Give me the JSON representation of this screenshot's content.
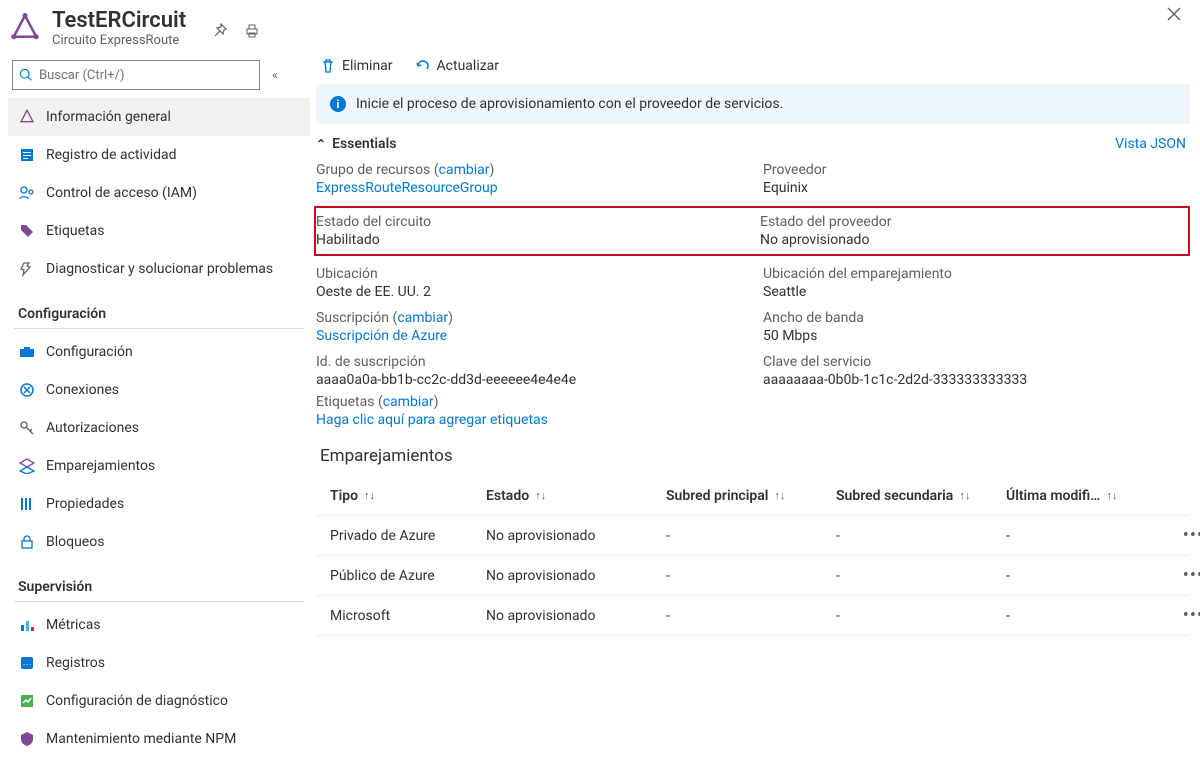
{
  "header": {
    "title": "TestERCircuit",
    "subtitle": "Circuito ExpressRoute"
  },
  "sidebar": {
    "search_placeholder": "Buscar (Ctrl+/)",
    "items_top": [
      {
        "label": "Información general"
      },
      {
        "label": "Registro de actividad"
      },
      {
        "label": "Control de acceso (IAM)"
      },
      {
        "label": "Etiquetas"
      },
      {
        "label": "Diagnosticar y solucionar problemas"
      }
    ],
    "section_config": "Configuración",
    "items_config": [
      {
        "label": "Configuración"
      },
      {
        "label": "Conexiones"
      },
      {
        "label": "Autorizaciones"
      },
      {
        "label": "Emparejamientos"
      },
      {
        "label": "Propiedades"
      },
      {
        "label": "Bloqueos"
      }
    ],
    "section_monitor": "Supervisión",
    "items_monitor": [
      {
        "label": "Métricas"
      },
      {
        "label": "Registros"
      },
      {
        "label": "Configuración de diagnóstico"
      },
      {
        "label": "Mantenimiento mediante NPM"
      }
    ]
  },
  "toolbar": {
    "delete": "Eliminar",
    "refresh": "Actualizar"
  },
  "banner": {
    "text": "Inicie el proceso de aprovisionamiento con el proveedor de servicios."
  },
  "essentials": {
    "title": "Essentials",
    "json_view": "Vista JSON",
    "change_label": "cambiar",
    "resource_group_label": "Grupo de recursos",
    "resource_group_value": "ExpressRouteResourceGroup",
    "provider_label": "Proveedor",
    "provider_value": "Equinix",
    "circuit_status_label": "Estado del circuito",
    "circuit_status_value": "Habilitado",
    "provider_status_label": "Estado del proveedor",
    "provider_status_value": "No aprovisionado",
    "location_label": "Ubicación",
    "location_value": "Oeste de EE. UU. 2",
    "peering_location_label": "Ubicación del emparejamiento",
    "peering_location_value": "Seattle",
    "subscription_label": "Suscripción",
    "subscription_value": "Suscripción de Azure",
    "bandwidth_label": "Ancho de banda",
    "bandwidth_value": "50 Mbps",
    "subscription_id_label": "Id. de suscripción",
    "subscription_id_value": "aaaa0a0a-bb1b-cc2c-dd3d-eeeeee4e4e4e",
    "service_key_label": "Clave del servicio",
    "service_key_value": "aaaaaaaa-0b0b-1c1c-2d2d-333333333333",
    "tags_label": "Etiquetas",
    "tags_add": "Haga clic aquí para agregar etiquetas"
  },
  "peerings": {
    "title": "Emparejamientos",
    "columns": {
      "type": "Tipo",
      "status": "Estado",
      "primary": "Subred principal",
      "secondary": "Subred secundaria",
      "last_mod": "Última modifi…"
    },
    "rows": [
      {
        "type": "Privado de Azure",
        "status": "No aprovisionado",
        "primary": "-",
        "secondary": "-",
        "last_mod": "-"
      },
      {
        "type": "Público de Azure",
        "status": "No aprovisionado",
        "primary": "-",
        "secondary": "-",
        "last_mod": "-"
      },
      {
        "type": "Microsoft",
        "status": "No aprovisionado",
        "primary": "-",
        "secondary": "-",
        "last_mod": "-"
      }
    ]
  }
}
